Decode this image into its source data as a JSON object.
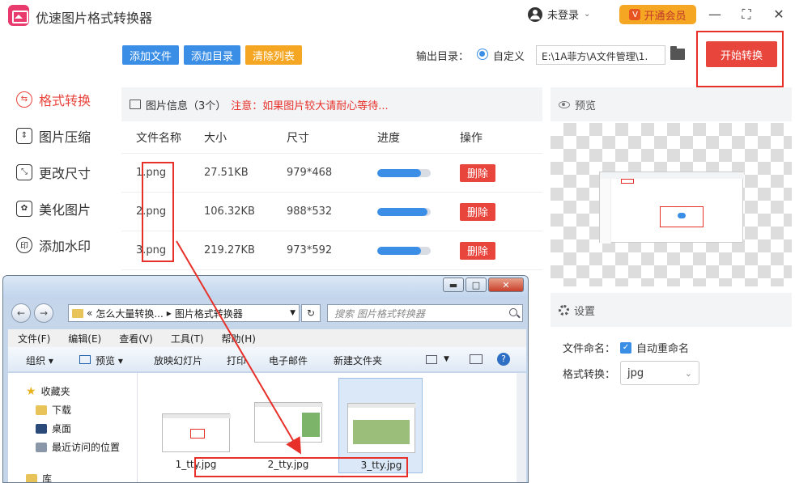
{
  "app": {
    "title": "优速图片格式转换器",
    "user_label": "未登录",
    "vip_label": "开通会员",
    "vip_icon": "V"
  },
  "sidebar": {
    "items": [
      {
        "label": "格式转换",
        "icon": "convert-icon",
        "active": true
      },
      {
        "label": "图片压缩",
        "icon": "compress-icon"
      },
      {
        "label": "更改尺寸",
        "icon": "resize-icon"
      },
      {
        "label": "美化图片",
        "icon": "beautify-icon"
      },
      {
        "label": "添加水印",
        "icon": "watermark-icon"
      }
    ]
  },
  "toolbar": {
    "add_file": "添加文件",
    "add_dir": "添加目录",
    "clear_list": "清除列表",
    "output_label": "输出目录：",
    "custom_label": "自定义",
    "path_value": "E:\\1A菲方\\A文件管理\\1.",
    "start_label": "开始转换"
  },
  "file_panel": {
    "title": "图片信息（3个）",
    "notice": "注意：如果图片较大请耐心等待...",
    "columns": [
      "文件名称",
      "大小",
      "尺寸",
      "进度",
      "操作"
    ],
    "delete_label": "删除",
    "rows": [
      {
        "name": "1.png",
        "size": "27.51KB",
        "dims": "979*468",
        "progress": 0.82
      },
      {
        "name": "2.png",
        "size": "106.32KB",
        "dims": "988*532",
        "progress": 0.94
      },
      {
        "name": "3.png",
        "size": "219.27KB",
        "dims": "973*592",
        "progress": 0.82
      }
    ]
  },
  "preview": {
    "title": "预览"
  },
  "settings": {
    "title": "设置",
    "naming_label": "文件命名：",
    "auto_rename": "自动重命名",
    "format_label": "格式转换：",
    "format_value": "jpg"
  },
  "explorer": {
    "ctrl_min": "▬",
    "ctrl_max": "□",
    "ctrl_close": "✕",
    "addr_prefix": "«",
    "addr_parent": "怎么大量转换...",
    "addr_sep": "▸",
    "addr_current": "图片格式转换器",
    "search_placeholder": "搜索 图片格式转换器",
    "menu": [
      "文件(F)",
      "编辑(E)",
      "查看(V)",
      "工具(T)",
      "帮助(H)"
    ],
    "commands": {
      "organize": "组织 ▾",
      "preview": "预览 ▾",
      "slideshow": "放映幻灯片",
      "print": "打印",
      "email": "电子邮件",
      "new_folder": "新建文件夹"
    },
    "nav": {
      "favorites": "收藏夹",
      "downloads": "下载",
      "desktop": "桌面",
      "recent": "最近访问的位置",
      "library": "库"
    },
    "files": [
      "1_tty.jpg",
      "2_tty.jpg",
      "3_tty.jpg"
    ]
  },
  "colors": {
    "accent_red": "#e8453c",
    "accent_blue": "#3a8ee6",
    "vip_orange": "#f5a623",
    "annotation_red": "#e8302a"
  }
}
